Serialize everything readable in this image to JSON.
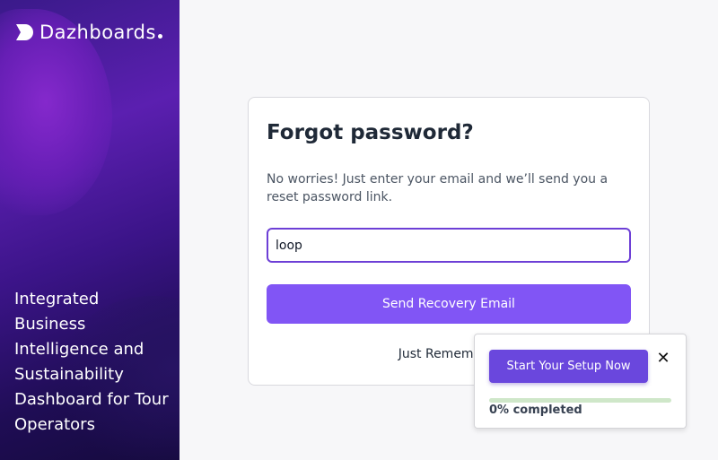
{
  "sidebar": {
    "logo": {
      "text": "Dazhboards",
      "icon": "dazhboards-logo-icon"
    },
    "tagline": "Integrated Business Intelligence and Sustainability Dashboard for Tour Operators"
  },
  "form": {
    "title": "Forgot password?",
    "description": "No worries! Just enter your email and we’ll send you a reset password link.",
    "email_value": "loop",
    "submit_label": "Send Recovery Email",
    "remember_text": "Just Remember?"
  },
  "setup": {
    "button_label": "Start Your Setup Now",
    "close_icon": "close-icon",
    "progress_percent": 0,
    "progress_text": "0% completed"
  },
  "colors": {
    "accent": "#8155f5",
    "setup_button": "#6a47dd",
    "input_border": "#6d3fd6",
    "progress_track": "#cfe7c9"
  }
}
